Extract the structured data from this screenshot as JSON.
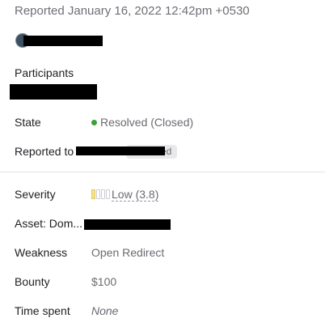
{
  "report": {
    "reported_line": "Reported January 16, 2022 12:42pm +0530"
  },
  "participants": {
    "label": "Participants"
  },
  "state": {
    "label": "State",
    "value": "Resolved (Closed)",
    "dot_color": "#3aa13a"
  },
  "reported_to": {
    "label": "Reported to",
    "badge_visible_text": "ed"
  },
  "details": {
    "severity_label": "Severity",
    "severity_value": "Low (3.8)",
    "severity_level_filled": 1,
    "severity_level_total": 4,
    "asset_label": "Asset: Dom...",
    "weakness_label": "Weakness",
    "weakness_value": "Open Redirect",
    "bounty_label": "Bounty",
    "bounty_value": "$100",
    "time_spent_label": "Time spent",
    "time_spent_value": "None"
  }
}
